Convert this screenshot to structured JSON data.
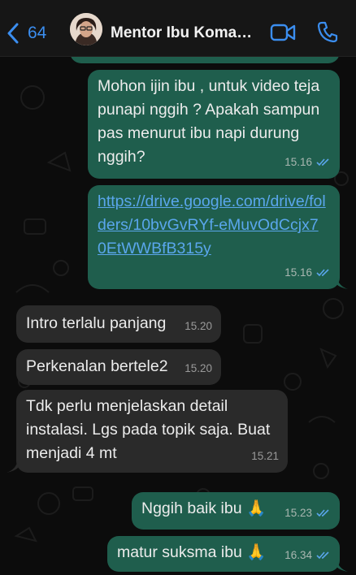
{
  "header": {
    "back_count": "64",
    "contact_name": "Mentor Ibu Koman..."
  },
  "messages": [
    {
      "direction": "out",
      "text": "Mohon ijin ibu , untuk video teja punapi nggih ? Apakah sampun pas menurut ibu napi durung nggih?",
      "time": "15.16",
      "status": "read"
    },
    {
      "direction": "out",
      "text": "https://drive.google.com/drive/folders/10bvGvRYf-eMuvOdCcjx70EtWWBfB315y",
      "time": "15.16",
      "status": "read",
      "is_link": true
    },
    {
      "direction": "in",
      "text": "Intro terlalu panjang",
      "time": "15.20"
    },
    {
      "direction": "in",
      "text": "Perkenalan bertele2",
      "time": "15.20"
    },
    {
      "direction": "in",
      "text": "Tdk perlu menjelaskan detail instalasi. Lgs pada topik saja. Buat menjadi 4 mt",
      "time": "15.21"
    },
    {
      "direction": "out",
      "text": "Nggih baik ibu 🙏",
      "time": "15.23",
      "status": "read"
    },
    {
      "direction": "out",
      "text": "matur suksma ibu 🙏",
      "time": "16.34",
      "status": "read"
    }
  ],
  "colors": {
    "outgoing_bubble": "#1f5e4d",
    "incoming_bubble": "#2a2a2a",
    "accent_blue": "#3b8ef0",
    "link": "#5aa6ec"
  },
  "icons": {
    "back": "chevron-left-icon",
    "video": "video-camera-icon",
    "call": "phone-icon",
    "read": "double-check-icon",
    "emoji": "folded-hands-emoji"
  }
}
